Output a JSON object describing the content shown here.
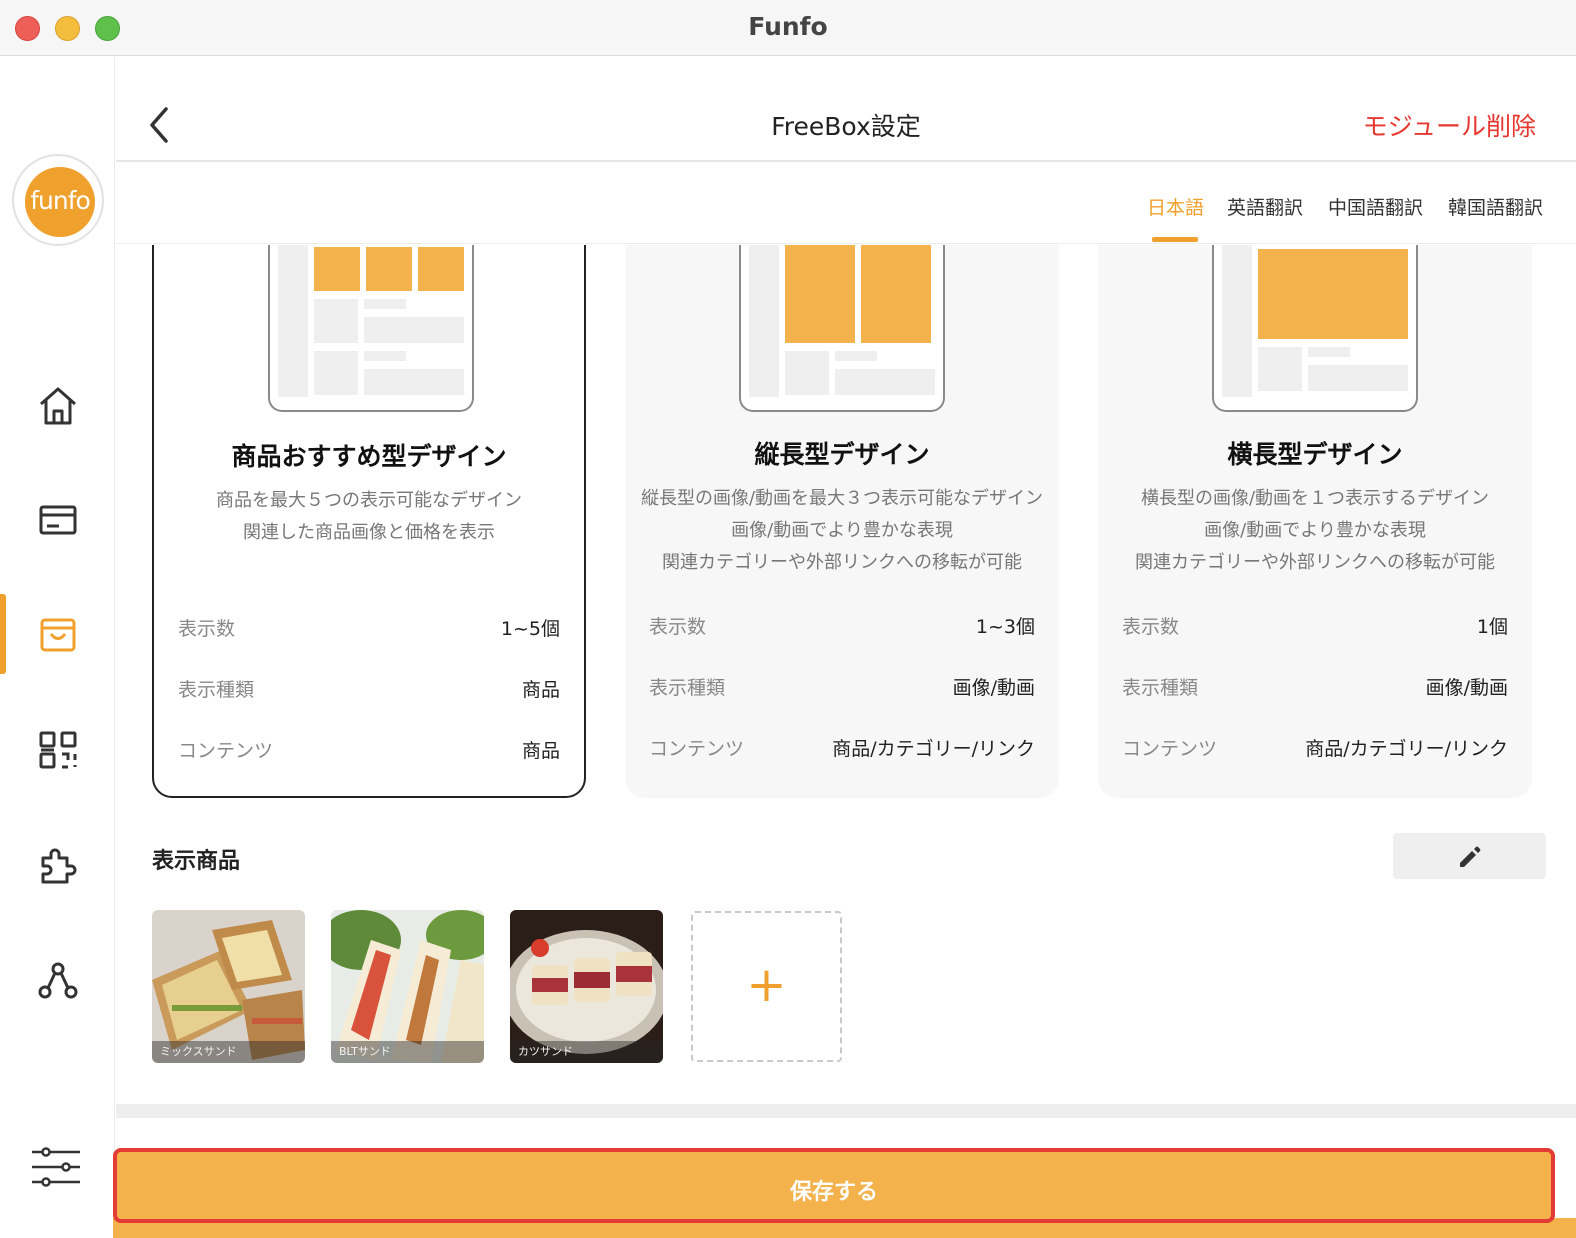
{
  "window": {
    "title": "Funfo"
  },
  "sidebar": {
    "logo_text": "funfo",
    "items": [
      {
        "name": "home",
        "icon": "home-icon"
      },
      {
        "name": "card",
        "icon": "card-icon"
      },
      {
        "name": "shop",
        "icon": "shopping-bag-icon",
        "active": true
      },
      {
        "name": "qr",
        "icon": "qr-code-icon"
      },
      {
        "name": "plugin",
        "icon": "puzzle-icon"
      },
      {
        "name": "network",
        "icon": "network-icon"
      },
      {
        "name": "settings",
        "icon": "sliders-icon"
      }
    ]
  },
  "header": {
    "title": "FreeBox設定",
    "delete_label": "モジュール削除"
  },
  "lang_tabs": [
    {
      "label": "日本語",
      "active": true
    },
    {
      "label": "英語翻訳"
    },
    {
      "label": "中国語翻訳"
    },
    {
      "label": "韓国語翻訳"
    }
  ],
  "designs": [
    {
      "title": "商品おすすめ型デザイン",
      "selected": true,
      "desc": [
        "商品を最大５つの表示可能なデザイン",
        "関連した商品画像と価格を表示"
      ],
      "specs": [
        {
          "label": "表示数",
          "value": "1~5個"
        },
        {
          "label": "表示種類",
          "value": "商品"
        },
        {
          "label": "コンテンツ",
          "value": "商品"
        }
      ]
    },
    {
      "title": "縦長型デザイン",
      "desc": [
        "縦長型の画像/動画を最大３つ表示可能なデザイン",
        "画像/動画でより豊かな表現",
        "関連カテゴリーや外部リンクへの移転が可能"
      ],
      "specs": [
        {
          "label": "表示数",
          "value": "1~3個"
        },
        {
          "label": "表示種類",
          "value": "画像/動画"
        },
        {
          "label": "コンテンツ",
          "value": "商品/カテゴリー/リンク"
        }
      ]
    },
    {
      "title": "横長型デザイン",
      "desc": [
        "横長型の画像/動画を１つ表示するデザイン",
        "画像/動画でより豊かな表現",
        "関連カテゴリーや外部リンクへの移転が可能"
      ],
      "specs": [
        {
          "label": "表示数",
          "value": "1個"
        },
        {
          "label": "表示種類",
          "value": "画像/動画"
        },
        {
          "label": "コンテンツ",
          "value": "商品/カテゴリー/リンク"
        }
      ]
    }
  ],
  "products_section": {
    "title": "表示商品",
    "items": [
      {
        "caption": "ミックスサンド"
      },
      {
        "caption": "BLTサンド"
      },
      {
        "caption": "カツサンド"
      }
    ],
    "add_symbol": "+"
  },
  "save_label": "保存する",
  "colors": {
    "accent": "#f0a02c",
    "danger": "#e6382f",
    "save_bg": "#f4b24c"
  }
}
